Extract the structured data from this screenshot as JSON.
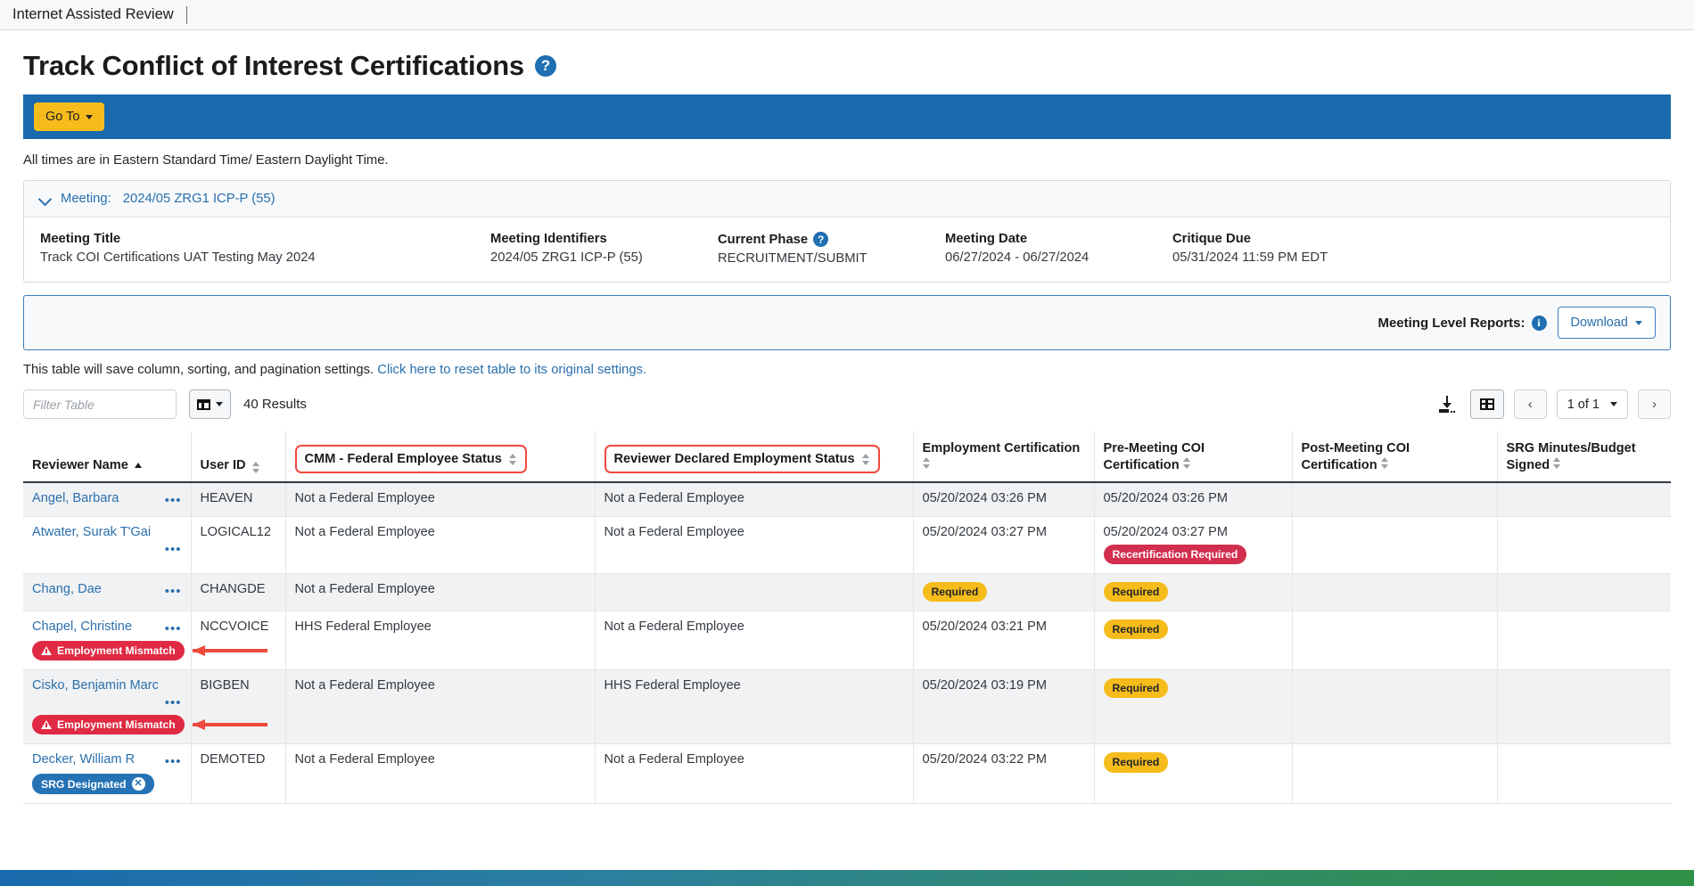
{
  "browser": {
    "tab_title": "Internet Assisted Review"
  },
  "header": {
    "page_title": "Track Conflict of Interest Certifications",
    "help_icon": "help-circle-icon",
    "goto_button": "Go To",
    "times_note": "All times are in Eastern Standard Time/ Eastern Daylight Time."
  },
  "meeting_panel": {
    "collapse_icon": "chevron-down-icon",
    "header_label": "Meeting:",
    "header_value": "2024/05 ZRG1 ICP-P (55)",
    "fields": [
      {
        "label": "Meeting Title",
        "value": "Track COI Certifications UAT Testing May 2024",
        "help": false
      },
      {
        "label": "Meeting Identifiers",
        "value": "2024/05 ZRG1 ICP-P (55)",
        "help": false
      },
      {
        "label": "Current Phase",
        "value": "RECRUITMENT/SUBMIT",
        "help": true
      },
      {
        "label": "Meeting Date",
        "value": "06/27/2024 - 06/27/2024",
        "help": false
      },
      {
        "label": "Critique Due",
        "value": "05/31/2024 11:59 PM EDT",
        "help": false
      }
    ]
  },
  "reports": {
    "label": "Meeting Level Reports:",
    "info_icon": "info-circle-icon",
    "download_button": "Download"
  },
  "table_note": {
    "text": "This table will save column, sorting, and pagination settings.",
    "link": "Click here to reset table to its original settings."
  },
  "toolbar": {
    "filter_placeholder": "Filter Table",
    "filter_value": "",
    "columns_icon": "columns-icon",
    "results_count": "40 Results",
    "download_icon": "download-icon",
    "grid_icon": "grid-view-icon",
    "prev_icon": "chevron-left-icon",
    "next_icon": "chevron-right-icon",
    "page_indicator": "1 of 1"
  },
  "table": {
    "columns": [
      {
        "label": "Reviewer Name",
        "sort": "asc",
        "highlight": false,
        "wrap": false
      },
      {
        "label": "User ID",
        "sort": "both",
        "highlight": false,
        "wrap": false
      },
      {
        "label": "CMM - Federal Employee Status",
        "sort": "both",
        "highlight": true,
        "wrap": false
      },
      {
        "label": "Reviewer Declared Employment Status",
        "sort": "both",
        "highlight": true,
        "wrap": false
      },
      {
        "label": "Employment Certification",
        "sort": "both",
        "highlight": false,
        "wrap": true
      },
      {
        "label": "Pre-Meeting COI Certification",
        "sort": "both",
        "highlight": false,
        "wrap": true
      },
      {
        "label": "Post-Meeting COI Certification",
        "sort": "both",
        "highlight": false,
        "wrap": true
      },
      {
        "label": "SRG Minutes/Budget Signed",
        "sort": "both",
        "highlight": false,
        "wrap": true
      }
    ],
    "rows": [
      {
        "name": "Angel, Barbara",
        "kebab_below": false,
        "badges": [],
        "user_id": "HEAVEN",
        "cmm_status": "Not a Federal Employee",
        "declared_status": "Not a Federal Employee",
        "employment_cert": "05/20/2024 03:26 PM",
        "employment_cert_badge": null,
        "pre_coi": "05/20/2024 03:26 PM",
        "pre_coi_badge": null,
        "post_coi": "",
        "srg_signed": ""
      },
      {
        "name": "Atwater, Surak T'Gai",
        "kebab_below": true,
        "badges": [],
        "user_id": "LOGICAL12",
        "cmm_status": "Not a Federal Employee",
        "declared_status": "Not a Federal Employee",
        "employment_cert": "05/20/2024 03:27 PM",
        "employment_cert_badge": null,
        "pre_coi": "05/20/2024 03:27 PM",
        "pre_coi_badge": {
          "text": "Recertification Required",
          "style": "crimson"
        },
        "post_coi": "",
        "srg_signed": ""
      },
      {
        "name": "Chang, Dae",
        "kebab_below": false,
        "badges": [],
        "user_id": "CHANGDE",
        "cmm_status": "Not a Federal Employee",
        "declared_status": "",
        "employment_cert": "",
        "employment_cert_badge": {
          "text": "Required",
          "style": "warning"
        },
        "pre_coi": "",
        "pre_coi_badge": {
          "text": "Required",
          "style": "warning"
        },
        "post_coi": "",
        "srg_signed": ""
      },
      {
        "name": "Chapel, Christine",
        "kebab_below": false,
        "badges": [
          {
            "text": "Employment Mismatch",
            "style": "danger",
            "icon": "warning-triangle-icon"
          }
        ],
        "user_id": "NCCVOICE",
        "cmm_status": "HHS Federal Employee",
        "declared_status": "Not a Federal Employee",
        "employment_cert": "05/20/2024 03:21 PM",
        "employment_cert_badge": null,
        "pre_coi": "",
        "pre_coi_badge": {
          "text": "Required",
          "style": "warning"
        },
        "post_coi": "",
        "srg_signed": ""
      },
      {
        "name": "Cisko, Benjamin Marc",
        "kebab_below": true,
        "badges": [
          {
            "text": "Employment Mismatch",
            "style": "danger",
            "icon": "warning-triangle-icon"
          }
        ],
        "user_id": "BIGBEN",
        "cmm_status": "Not a Federal Employee",
        "declared_status": "HHS Federal Employee",
        "employment_cert": "05/20/2024 03:19 PM",
        "employment_cert_badge": null,
        "pre_coi": "",
        "pre_coi_badge": {
          "text": "Required",
          "style": "warning"
        },
        "post_coi": "",
        "srg_signed": ""
      },
      {
        "name": "Decker, William R",
        "kebab_below": false,
        "badges": [
          {
            "text": "SRG Designated",
            "style": "primary",
            "icon": "close-circle-icon"
          }
        ],
        "user_id": "DEMOTED",
        "cmm_status": "Not a Federal Employee",
        "declared_status": "Not a Federal Employee",
        "employment_cert": "05/20/2024 03:22 PM",
        "employment_cert_badge": null,
        "pre_coi": "",
        "pre_coi_badge": {
          "text": "Required",
          "style": "warning"
        },
        "post_coi": "",
        "srg_signed": ""
      }
    ],
    "kebab_glyph": "•••"
  },
  "colors": {
    "accent_blue": "#1a6aad",
    "link_blue": "#2a6fad",
    "warning_yellow": "#f6bc1c",
    "danger_red": "#e02a43",
    "crimson": "#d22e4e",
    "annotation_red": "#f0493e"
  }
}
